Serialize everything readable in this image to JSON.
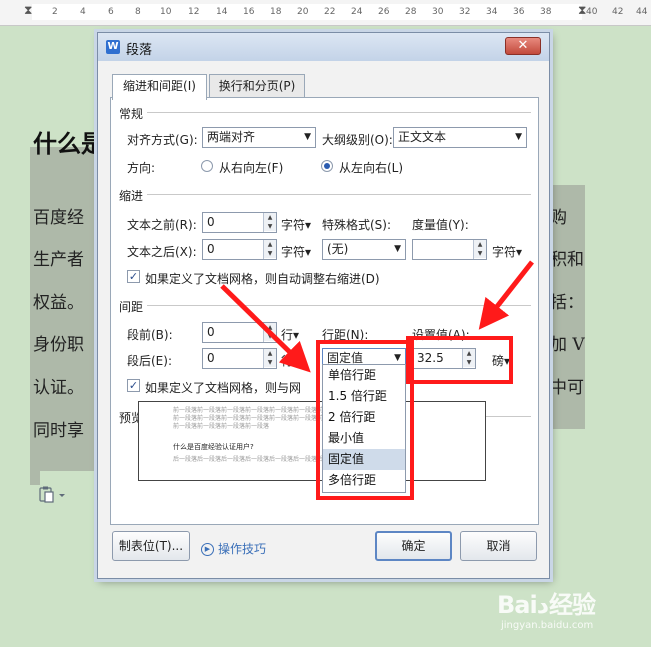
{
  "ruler": {
    "ticks": [
      "2",
      "4",
      "6",
      "8",
      "10",
      "12",
      "14",
      "16",
      "18",
      "20",
      "22",
      "24",
      "26",
      "28",
      "30",
      "32",
      "34",
      "36",
      "38",
      "40",
      "42",
      "44"
    ]
  },
  "document": {
    "title": "什么是",
    "lines": [
      "百度经",
      "生产者",
      "权益。",
      "身份职",
      "认证。",
      "同时享"
    ],
    "right_chars": [
      "购",
      "积和",
      "括：",
      "加 V",
      "中可"
    ]
  },
  "dialog": {
    "title": "段落",
    "close_label": "✕",
    "tabs": [
      "缩进和间距(I)",
      "换行和分页(P)"
    ],
    "general": {
      "heading": "常规",
      "align_label": "对齐方式(G):",
      "align_value": "两端对齐",
      "outline_label": "大纲级别(O):",
      "outline_value": "正文文本",
      "direction_label": "方向:",
      "rtl_label": "从右向左(F)",
      "ltr_label": "从左向右(L)"
    },
    "indent": {
      "heading": "缩进",
      "before_label": "文本之前(R):",
      "before_value": "0",
      "before_unit": "字符▾",
      "after_label": "文本之后(X):",
      "after_value": "0",
      "after_unit": "字符▾",
      "special_label": "特殊格式(S):",
      "special_value": "(无)",
      "measure_label": "度量值(Y):",
      "measure_value": "",
      "measure_unit": "字符▾",
      "grid_check_label": "如果定义了文档网格，则自动调整右缩进(D)"
    },
    "spacing": {
      "heading": "间距",
      "before_label": "段前(B):",
      "before_value": "0",
      "before_unit": "行▾",
      "after_label": "段后(E):",
      "after_value": "0",
      "after_unit": "行▾",
      "line_spacing_label": "行距(N):",
      "line_spacing_value": "固定值",
      "set_value_label": "设置值(A):",
      "set_value": "32.5",
      "set_value_unit": "磅▾",
      "grid_check_label": "如果定义了文档网格，则与网"
    },
    "line_spacing_options": [
      "单倍行距",
      "1.5 倍行距",
      "2 倍行距",
      "最小值",
      "固定值",
      "多倍行距"
    ],
    "line_spacing_selected": "固定值",
    "preview": {
      "heading": "预览",
      "filler": "前一段落前一段落前一段落前一段落前一段落前一段落前一段落前一段落前一段落",
      "filler2": "前一段落前一段落前一段落前一段落",
      "sample": "什么是百度经验认证用户?",
      "next": "后一段落后一段落后一段落后一段落后一段落后一段落后一段落后一段落后一段落"
    },
    "buttons": {
      "tabs": "制表位(T)...",
      "tips": "操作技巧",
      "ok": "确定",
      "cancel": "取消"
    }
  },
  "watermark": {
    "main": "Baiد经验",
    "sub": "jingyan.baidu.com"
  },
  "colors": {
    "page_bg": "#cde2c7",
    "highlight": "#aeb9a9",
    "annotation": "#ff1a1a",
    "link": "#3a6fb8"
  }
}
